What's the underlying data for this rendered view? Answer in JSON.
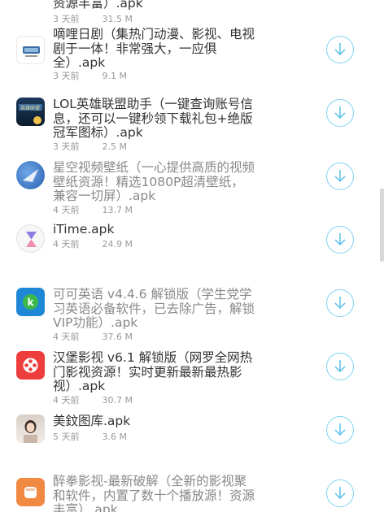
{
  "items": [
    {
      "title": "资源丰富）.apk",
      "time": "3 天前",
      "size": "31.5 M",
      "icon": "app-icon",
      "dim": false
    },
    {
      "title": "嘀哩日剧（集热门动漫、影视、电视剧于一体！非常强大，一应俱全）.apk",
      "time": "3 天前",
      "size": "9.1 M",
      "icon": "diliriju-app-icon",
      "dim": false
    },
    {
      "title": "LOL英雄联盟助手（一键查询账号信息，还可以一键秒领下载礼包+绝版冠军图标）.apk",
      "time": "3 天前",
      "size": "2.5 M",
      "icon": "lol-helper-app-icon",
      "dim": false
    },
    {
      "title": "星空视频壁纸（一心提供高质的视频壁纸资源！精选1080P超清壁纸，兼容一切屏）.apk",
      "time": "4 天前",
      "size": "13.7 M",
      "icon": "xingkong-wallpaper-app-icon",
      "dim": true
    },
    {
      "title": "iTime.apk",
      "time": "4 天前",
      "size": "24.9 M",
      "icon": "hourglass-app-icon",
      "dim": false
    },
    {
      "title": "可可英语 v4.4.6 解锁版（学生党学习英语必备软件，已去除广告，解锁VIP功能）.apk",
      "time": "4 天前",
      "size": "37.6 M",
      "icon": "keke-english-app-icon",
      "dim": true
    },
    {
      "title": "汉堡影视 v6.1 解锁版（网罗全网热门影视资源！实时更新最新最热影视）.apk",
      "time": "4 天前",
      "size": "30.7 M",
      "icon": "hanbao-video-app-icon",
      "dim": false
    },
    {
      "title": "美鈫图库.apk",
      "time": "5 天前",
      "size": "3.6 M",
      "icon": "photo-gallery-app-icon",
      "dim": false
    },
    {
      "title": "醉拳影视-最新破解（全新的影视聚和软件，内置了数十个播放源！资源丰富）.apk",
      "time": "",
      "size": "",
      "icon": "fist-video-app-icon",
      "dim": true
    }
  ],
  "colors": {
    "download_ring": "#7fd3f0",
    "download_arrow": "#5bc0e8",
    "title": "#333333",
    "meta": "#999999"
  }
}
